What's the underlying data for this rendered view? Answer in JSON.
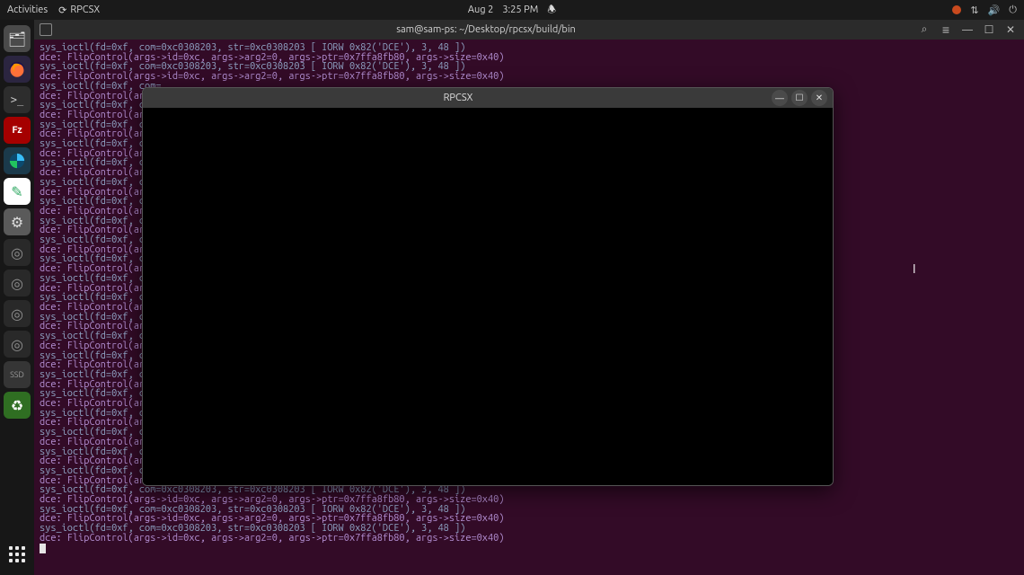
{
  "topbar": {
    "activities": "Activities",
    "app_name": "RPCSX",
    "date": "Aug 2",
    "time": "3:25 PM"
  },
  "dock": {
    "items": [
      {
        "name": "files-icon",
        "glyph": "🗂"
      },
      {
        "name": "firefox-icon",
        "glyph": ""
      },
      {
        "name": "terminal-icon",
        "glyph": ">_"
      },
      {
        "name": "filezilla-icon",
        "glyph": "Fz"
      },
      {
        "name": "browser-icon",
        "glyph": "◉"
      },
      {
        "name": "editor-icon",
        "glyph": "✎"
      },
      {
        "name": "settings-icon",
        "glyph": "⚙"
      },
      {
        "name": "disk1-icon",
        "glyph": "◎"
      },
      {
        "name": "disk2-icon",
        "glyph": "◎"
      },
      {
        "name": "disk3-icon",
        "glyph": "◎"
      },
      {
        "name": "disk4-icon",
        "glyph": "◎"
      },
      {
        "name": "ssd-icon",
        "glyph": "SSD"
      },
      {
        "name": "trash-icon",
        "glyph": "♻"
      }
    ]
  },
  "terminal": {
    "title": "sam@sam-ps: ~/Desktop/rpcsx/build/bin",
    "ioctl_line": "sys_ioctl(fd=0xf, com=0xc0308203, str=0xc0308203 [ IORW 0x82('DCE'), 3, 48 ])",
    "dce_line": "dce: FlipControl(args->id=0xc, args->arg2=0, args->ptr=0x7ffa8fb80, args->size=0x40)",
    "ioctl_cut": "sys_ioctl(fd=0xf, com=",
    "dce_cut": "dce: FlipControl(args",
    "line_count_top_full": 4,
    "line_count_cut": 42,
    "line_count_bot_full": 6
  },
  "float_window": {
    "title": "RPCSX"
  }
}
